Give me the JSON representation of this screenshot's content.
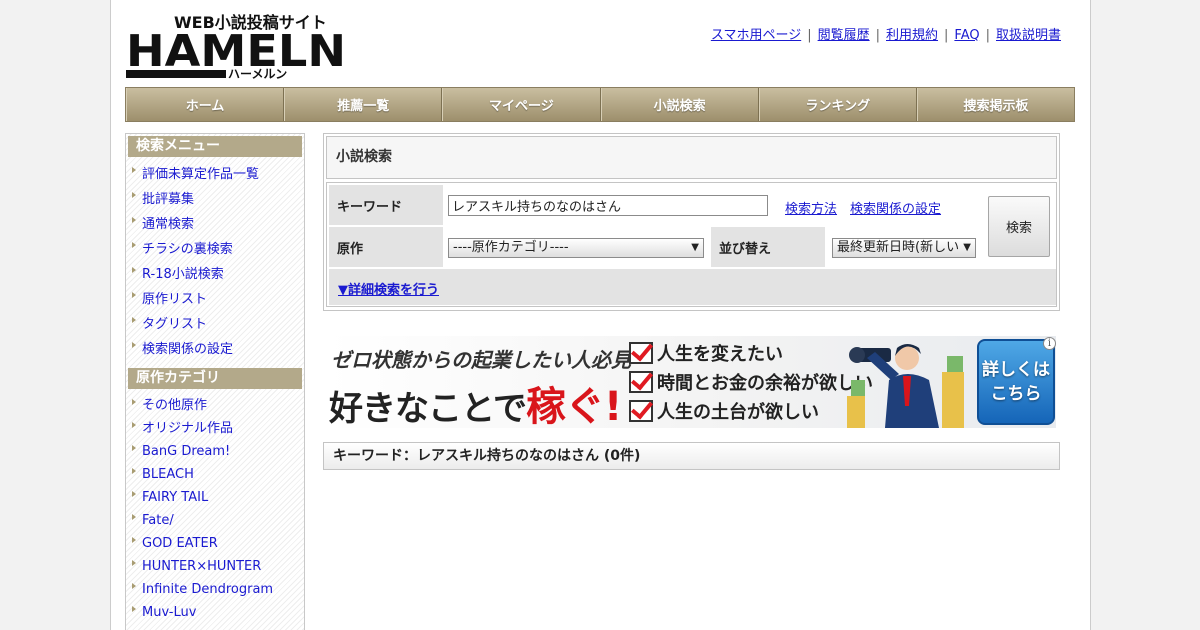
{
  "header": {
    "logo_main": "HAMELN",
    "logo_sub": "WEB小説投稿サイト",
    "logo_kana": "ハーメルン",
    "links": [
      "スマホ用ページ",
      "閲覧履歴",
      "利用規約",
      "FAQ",
      "取扱説明書"
    ]
  },
  "nav": {
    "items": [
      "ホーム",
      "推薦一覧",
      "マイページ",
      "小説検索",
      "ランキング",
      "捜索掲示板"
    ]
  },
  "sidebar": {
    "search_menu_title": "検索メニュー",
    "search_menu": [
      "評価未算定作品一覧",
      "批評募集",
      "通常検索",
      "チラシの裏検索",
      "R-18小説検索",
      "原作リスト",
      "タグリスト",
      "検索関係の設定"
    ],
    "category_title": "原作カテゴリ",
    "categories": [
      "その他原作",
      "オリジナル作品",
      "BanG Dream!",
      "BLEACH",
      "FAIRY TAIL",
      "Fate/",
      "GOD EATER",
      "HUNTER×HUNTER",
      "Infinite Dendrogram",
      "Muv-Luv"
    ]
  },
  "search": {
    "title": "小説検索",
    "keyword_label": "キーワード",
    "keyword_value": "レアスキル持ちのなのはさん",
    "method_link": "検索方法",
    "settings_link": "検索関係の設定",
    "original_label": "原作",
    "original_select": "----原作カテゴリ----",
    "sort_label": "並び替え",
    "sort_select": "最終更新日時(新しい",
    "search_button": "検索",
    "detail_link": "▼詳細検索を行う"
  },
  "banner": {
    "line1": "ゼロ状態からの起業したい人必見",
    "line2": "好きなことで",
    "line2_red": "稼ぐ!",
    "checks": [
      "人生を変えたい",
      "時間とお金の余裕が欲しい",
      "人生の土台が欲しい"
    ],
    "button": "詳しくは\nこちら",
    "info": "i"
  },
  "result": {
    "text": "キーワード：レアスキル持ちのなのはさん (0件)"
  },
  "colors": {
    "nav_bg": "#b3a98a",
    "link": "#1a1ad0",
    "banner_red": "#d9151b",
    "banner_button": "#1e74c6"
  }
}
